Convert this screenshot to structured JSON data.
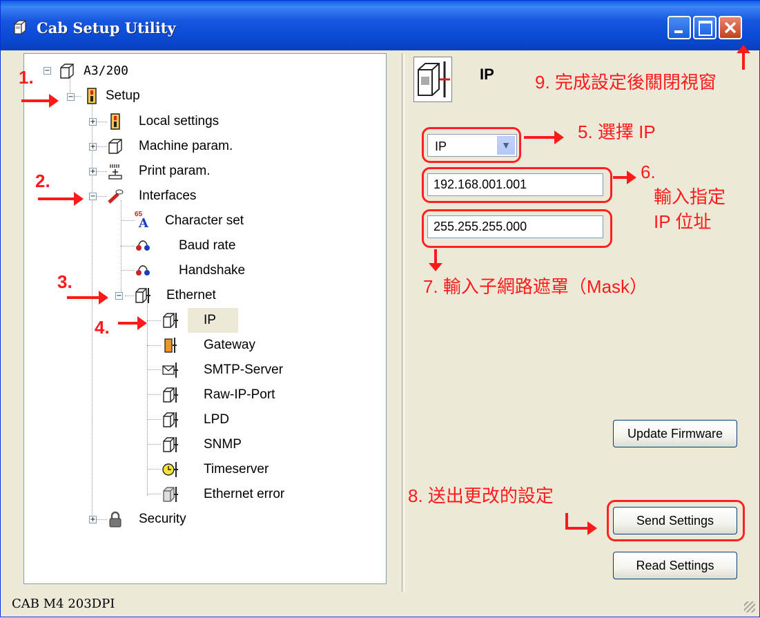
{
  "window": {
    "title": "Cab Setup Utility"
  },
  "tree": {
    "root": "A3/200",
    "setup": "Setup",
    "local_settings": "Local settings",
    "machine_param": "Machine param.",
    "print_param": "Print param.",
    "interfaces": "Interfaces",
    "character_set": "Character set",
    "baud_rate": "Baud rate",
    "handshake": "Handshake",
    "ethernet": "Ethernet",
    "ip": "IP",
    "gateway": "Gateway",
    "smtp_server": "SMTP-Server",
    "raw_ip_port": "Raw-IP-Port",
    "lpd": "LPD",
    "snmp": "SNMP",
    "timeserver": "Timeserver",
    "ethernet_error": "Ethernet error",
    "security": "Security",
    "character_set_icon_text": "65"
  },
  "panel": {
    "title": "IP",
    "select_value": "IP",
    "ip_value": "192.168.001.001",
    "mask_value": "255.255.255.000",
    "update_firmware": "Update Firmware",
    "send_settings": "Send Settings",
    "read_settings": "Read Settings"
  },
  "status": {
    "text": "CAB M4 203DPI"
  },
  "annotations": {
    "n1": "1.",
    "n2": "2.",
    "n3": "3.",
    "n4": "4.",
    "a5": "5. 選擇 IP",
    "a6_num": "6.",
    "a6_line1": "輸入指定",
    "a6_line2": "IP 位址",
    "a7": "7. 輸入子網路遮罩（Mask）",
    "a8": "8. 送出更改的設定",
    "a9": "9. 完成設定後關閉視窗"
  },
  "colors": {
    "annotation": "#ff1a1a",
    "titlebar": "#0b49d3"
  }
}
